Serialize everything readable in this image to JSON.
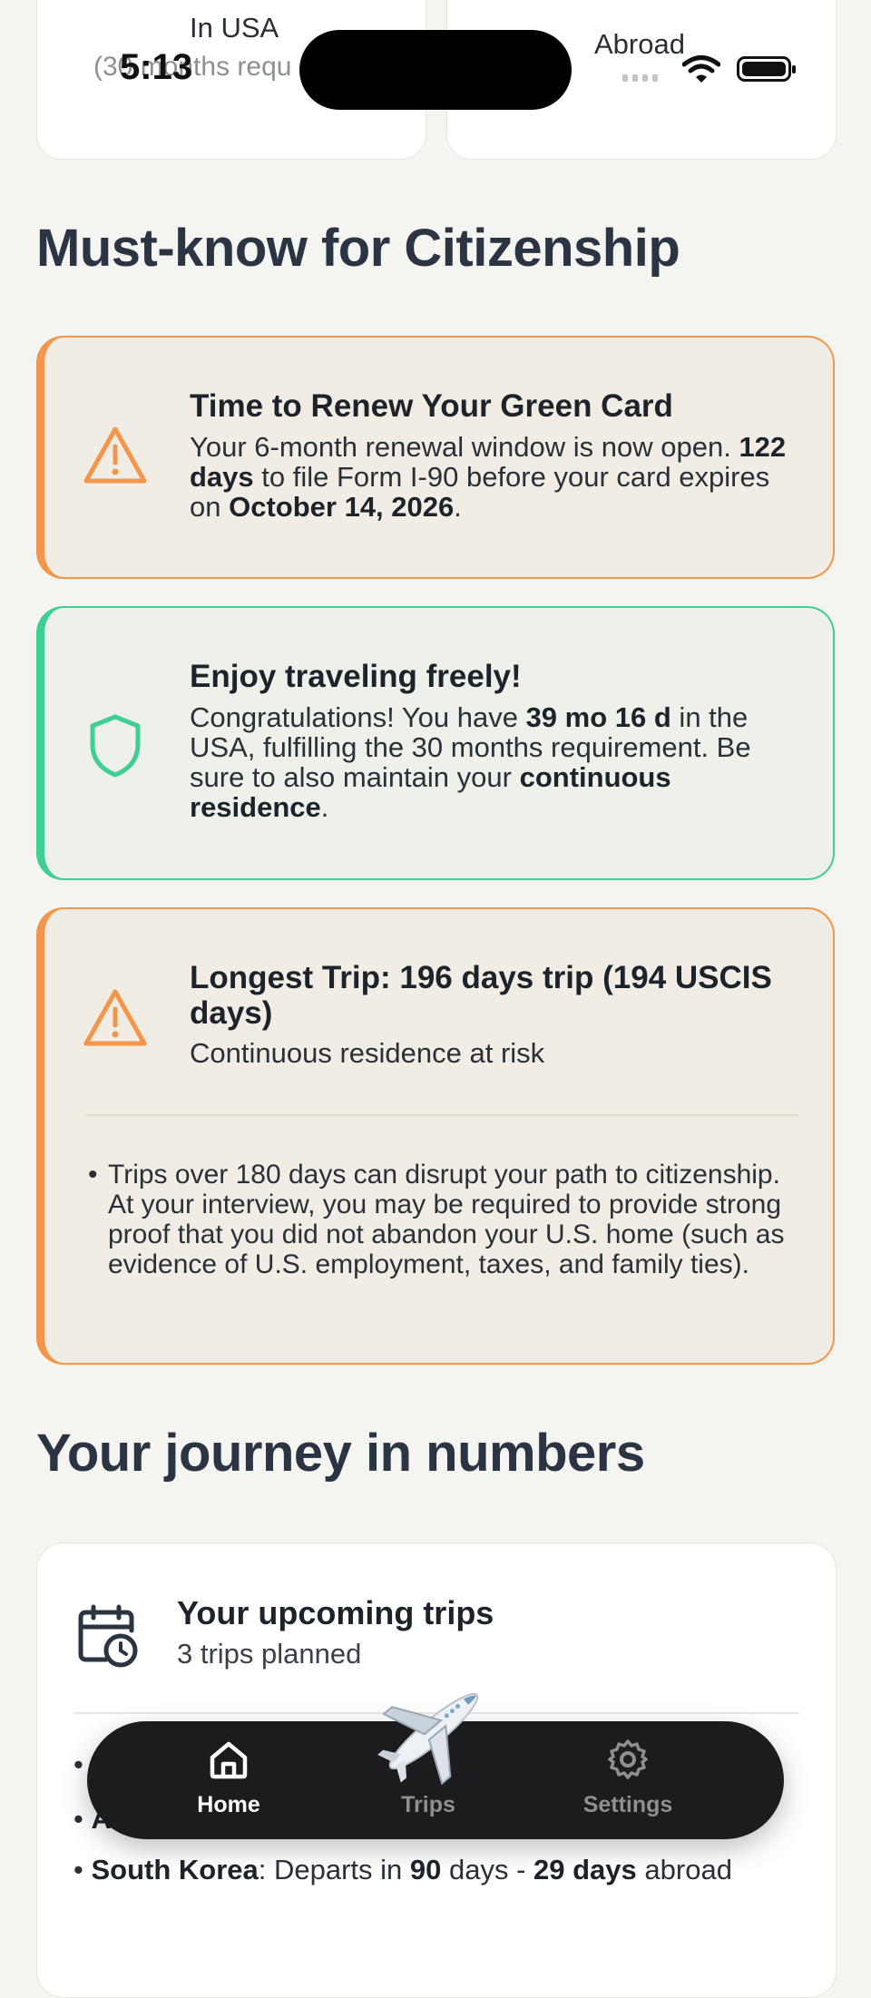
{
  "status_bar": {
    "time": "5:13"
  },
  "stats": {
    "usa_label": "In USA",
    "usa_sub": "(30 months requ",
    "abroad_label": "Abroad"
  },
  "must_know": {
    "title": "Must-know for Citizenship",
    "renew": {
      "title": "Time to Renew Your Green Card",
      "body_1": "Your 6-month renewal window is now open. ",
      "days_strong": "122 days",
      "body_2": " to file Form I-90 before your card expires on ",
      "date_strong": "October 14, 2026",
      "body_3": "."
    },
    "travel": {
      "title": "Enjoy traveling freely!",
      "body_1": "Congratulations! You have ",
      "duration_strong": "39 mo 16 d",
      "body_2": " in the USA, fulfilling the 30 months requirement. Be sure to also maintain your ",
      "residence_strong": "continuous residence",
      "body_3": "."
    },
    "longest_trip": {
      "title": "Longest Trip: 196 days trip (194 USCIS days)",
      "subtitle": "Continuous residence at risk",
      "bullet": "Trips over 180 days can disrupt your path to citizenship. At your interview, you may be required to provide strong proof that you did not abandon your U.S. home (such as evidence of U.S. employment, taxes, and family ties)."
    }
  },
  "journey": {
    "title": "Your journey in numbers",
    "upcoming": {
      "title": "Your upcoming trips",
      "subtitle": "3 trips planned",
      "row_1_prefix": "A",
      "row_3": {
        "country": "South Korea",
        "text_1": ": Departs in ",
        "days": "90",
        "text_2": " days - ",
        "abroad": "29 days",
        "text_3": " abroad"
      }
    }
  },
  "tabs": {
    "home": "Home",
    "trips": "Trips",
    "settings": "Settings"
  },
  "colors": {
    "warn": "#f3954a",
    "ok": "#3fcf93",
    "tab_active": "#ffffff",
    "tab_inactive": "#8e8e93"
  }
}
